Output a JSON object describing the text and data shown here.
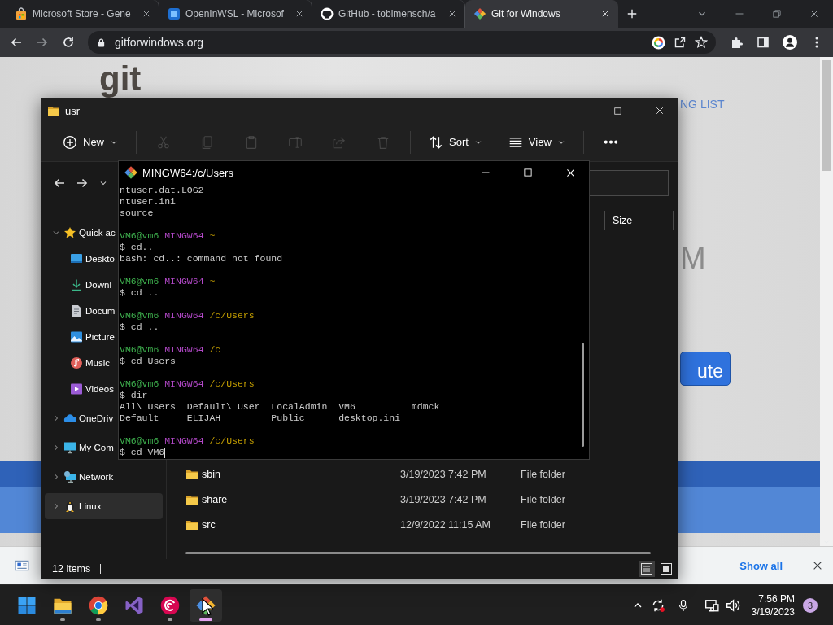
{
  "browser": {
    "tabs": [
      {
        "title": "Microsoft Store - Gene",
        "selected": false
      },
      {
        "title": "OpenInWSL - Microsof",
        "selected": false
      },
      {
        "title": "GitHub - tobimensch/a",
        "selected": false
      },
      {
        "title": "Git for Windows",
        "selected": true
      }
    ],
    "url": "gitforwindows.org",
    "page": {
      "logo": "git",
      "nav_link": "NG LIST",
      "heading_fragment": "M",
      "button_fragment": "ute"
    },
    "download_bar": {
      "show_all": "Show all"
    }
  },
  "explorer": {
    "title": "usr",
    "toolbar": [
      {
        "kind": "new",
        "label": "New",
        "disabled": false
      },
      {
        "kind": "cut",
        "disabled": true
      },
      {
        "kind": "copy",
        "disabled": true
      },
      {
        "kind": "paste",
        "disabled": true
      },
      {
        "kind": "rename",
        "disabled": true
      },
      {
        "kind": "share",
        "disabled": true
      },
      {
        "kind": "delete",
        "disabled": true
      },
      {
        "kind": "sort",
        "label": "Sort",
        "disabled": false
      },
      {
        "kind": "view",
        "label": "View",
        "disabled": false
      },
      {
        "kind": "more",
        "disabled": false
      }
    ],
    "sidebar": [
      {
        "label": "Quick ac",
        "expanded": true,
        "selected": false,
        "children": [
          {
            "label": "Deskto",
            "selected": false
          },
          {
            "label": "Downl",
            "selected": false
          },
          {
            "label": "Docum",
            "selected": false
          },
          {
            "label": "Picture",
            "selected": false
          },
          {
            "label": "Music",
            "selected": false
          },
          {
            "label": "Videos",
            "selected": false
          }
        ]
      },
      {
        "label": "OneDriv",
        "expanded": false,
        "selected": false
      },
      {
        "label": "My Com",
        "expanded": false,
        "selected": false
      },
      {
        "label": "Network",
        "expanded": false,
        "selected": false
      },
      {
        "label": "Linux",
        "expanded": false,
        "selected": true
      }
    ],
    "columns": [
      "Size"
    ],
    "rows": [
      {
        "name": "sbin",
        "date": "3/19/2023 7:42 PM",
        "type": "File folder"
      },
      {
        "name": "share",
        "date": "3/19/2023 7:42 PM",
        "type": "File folder"
      },
      {
        "name": "src",
        "date": "12/9/2022 11:15 AM",
        "type": "File folder"
      }
    ],
    "status": "12 items"
  },
  "terminal": {
    "title": "MINGW64:/c/Users",
    "lines": [
      {
        "kind": "text",
        "text": "ntuser.dat.LOG2"
      },
      {
        "kind": "text",
        "text": "ntuser.ini"
      },
      {
        "kind": "text",
        "text": "source"
      },
      {
        "kind": "blank"
      },
      {
        "kind": "prompt",
        "user": "VM6@vm6",
        "env": "MINGW64",
        "path": "~"
      },
      {
        "kind": "text",
        "text": "$ cd.."
      },
      {
        "kind": "text",
        "text": "bash: cd..: command not found"
      },
      {
        "kind": "blank"
      },
      {
        "kind": "prompt",
        "user": "VM6@vm6",
        "env": "MINGW64",
        "path": "~"
      },
      {
        "kind": "text",
        "text": "$ cd .."
      },
      {
        "kind": "blank"
      },
      {
        "kind": "prompt",
        "user": "VM6@vm6",
        "env": "MINGW64",
        "path": "/c/Users"
      },
      {
        "kind": "text",
        "text": "$ cd .."
      },
      {
        "kind": "blank"
      },
      {
        "kind": "prompt",
        "user": "VM6@vm6",
        "env": "MINGW64",
        "path": "/c"
      },
      {
        "kind": "text",
        "text": "$ cd Users"
      },
      {
        "kind": "blank"
      },
      {
        "kind": "prompt",
        "user": "VM6@vm6",
        "env": "MINGW64",
        "path": "/c/Users"
      },
      {
        "kind": "text",
        "text": "$ dir"
      },
      {
        "kind": "text",
        "text": "All\\ Users  Default\\ User  LocalAdmin  VM6          mdmck"
      },
      {
        "kind": "text",
        "text": "Default     ELIJAH         Public      desktop.ini"
      },
      {
        "kind": "blank"
      },
      {
        "kind": "prompt",
        "user": "VM6@vm6",
        "env": "MINGW64",
        "path": "/c/Users"
      }
    ],
    "input": "$ cd VM6"
  },
  "taskbar": {
    "apps": [
      {
        "kind": "windows",
        "running": false,
        "active": false
      },
      {
        "kind": "explorer",
        "running": true,
        "active": false
      },
      {
        "kind": "chrome",
        "running": true,
        "active": false
      },
      {
        "kind": "vs",
        "running": false,
        "active": false
      },
      {
        "kind": "debian",
        "running": true,
        "active": false
      },
      {
        "kind": "git",
        "running": true,
        "active": true
      }
    ],
    "time": "7:56 PM",
    "date": "3/19/2023",
    "notifications": "3"
  }
}
